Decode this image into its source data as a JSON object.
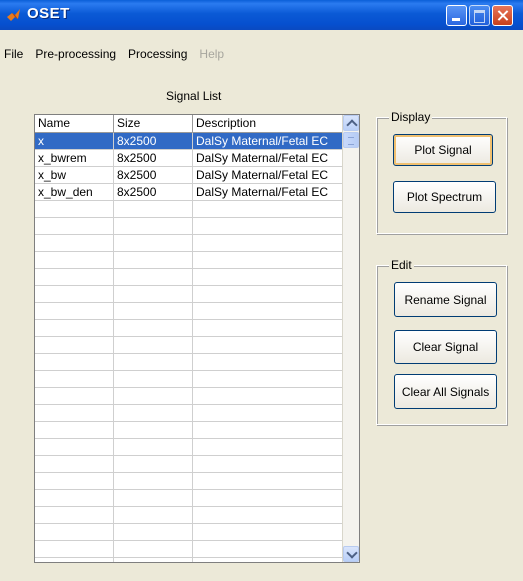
{
  "window": {
    "title": "OSET"
  },
  "menu": [
    "File",
    "Pre-processing",
    "Processing",
    "Help"
  ],
  "signal_list": {
    "label": "Signal List",
    "columns": [
      "Name",
      "Size",
      "Description"
    ],
    "rows": [
      [
        "x",
        "8x2500",
        "DalSy Maternal/Fetal EC"
      ],
      [
        "x_bwrem",
        "8x2500",
        "DalSy Maternal/Fetal EC"
      ],
      [
        "x_bw",
        "8x2500",
        "DalSy Maternal/Fetal EC"
      ],
      [
        "x_bw_den",
        "8x2500",
        "DalSy Maternal/Fetal EC"
      ]
    ],
    "selected_row": 0
  },
  "display": {
    "title": "Display",
    "plot_signal": "Plot Signal",
    "plot_spectrum": "Plot Spectrum"
  },
  "edit": {
    "title": "Edit",
    "rename_signal": "Rename Signal",
    "clear_signal": "Clear Signal",
    "clear_all_signals": "Clear All Signals"
  },
  "colors": {
    "titlebar": "#0a5fd8",
    "selection": "#316ac5",
    "background": "#ece9d8"
  },
  "icons": {
    "app": "matlab-logo-icon",
    "minimize": "minimize-icon",
    "maximize": "maximize-icon",
    "close": "close-icon"
  }
}
